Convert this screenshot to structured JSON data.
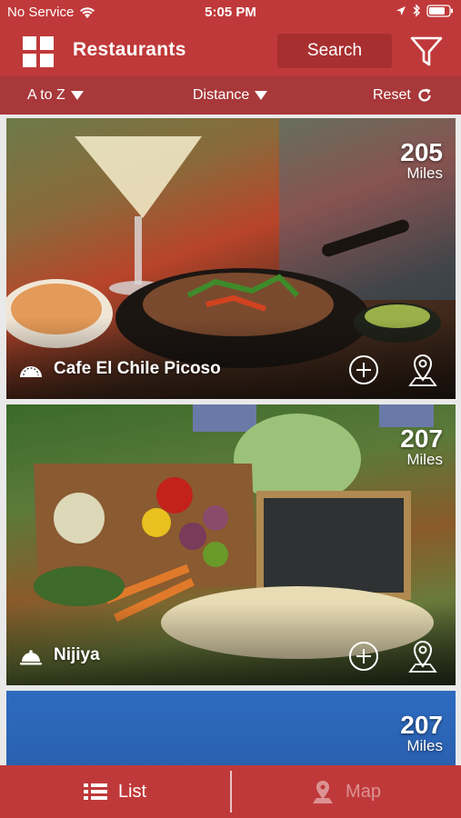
{
  "status_bar": {
    "carrier": "No Service",
    "time": "5:05 PM"
  },
  "header": {
    "title": "Restaurants",
    "search_label": "Search",
    "icons": {
      "menu": "grid-icon",
      "filter": "filter-icon"
    }
  },
  "sort_bar": {
    "sort_a_to_z": "A to Z",
    "sort_distance": "Distance",
    "reset": "Reset"
  },
  "restaurants": [
    {
      "name": "Cafe El Chile Picoso",
      "distance": "205",
      "unit": "Miles",
      "category_icon": "taco-icon"
    },
    {
      "name": "Nijiya",
      "distance": "207",
      "unit": "Miles",
      "category_icon": "cloche-icon"
    },
    {
      "name": "",
      "distance": "207",
      "unit": "Miles",
      "category_icon": ""
    }
  ],
  "tab_bar": {
    "list_label": "List",
    "map_label": "Map",
    "active": "List"
  },
  "colors": {
    "brand_red": "#c0393a",
    "sort_bar_red": "#a8383a",
    "search_bg": "#a82f30"
  }
}
